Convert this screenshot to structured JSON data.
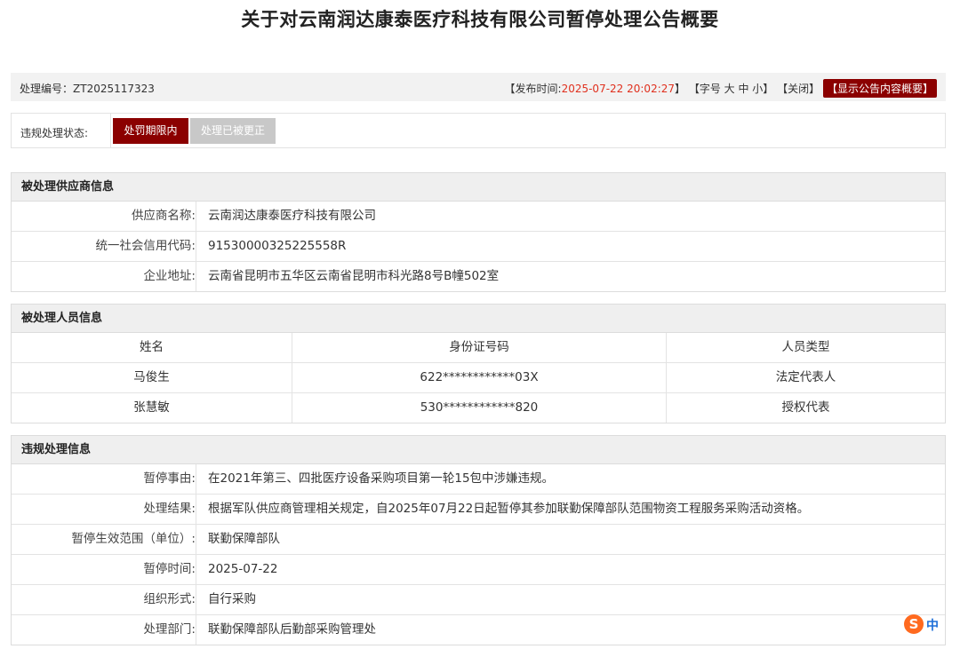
{
  "page": {
    "title": "关于对云南润达康泰医疗科技有限公司暂停处理公告概要"
  },
  "meta": {
    "serial_label": "处理编号：",
    "serial_value": "ZT2025117323",
    "publish_label_open": "【发布时间: ",
    "publish_time": "2025-07-22 20:02:27",
    "publish_close": "】",
    "font_size": "【字号 大 中 小】",
    "close": "【关闭】",
    "show_summary": "【显示公告内容概要】"
  },
  "status": {
    "label": "违规处理状态:",
    "active": "处罚期限内",
    "inactive": "处理已被更正"
  },
  "supplier": {
    "heading": "被处理供应商信息",
    "rows": [
      {
        "k": "供应商名称:",
        "v": "云南润达康泰医疗科技有限公司"
      },
      {
        "k": "统一社会信用代码:",
        "v": "91530000325225558R"
      },
      {
        "k": "企业地址:",
        "v": "云南省昆明市五华区云南省昆明市科光路8号B幢502室"
      }
    ]
  },
  "persons": {
    "heading": "被处理人员信息",
    "columns": [
      "姓名",
      "身份证号码",
      "人员类型"
    ],
    "rows": [
      [
        "马俊生",
        "622************03X",
        "法定代表人"
      ],
      [
        "张慧敏",
        "530************820",
        "授权代表"
      ]
    ]
  },
  "violation": {
    "heading": "违规处理信息",
    "rows": [
      {
        "k": "暂停事由:",
        "v": "在2021年第三、四批医疗设备采购项目第一轮15包中涉嫌违规。"
      },
      {
        "k": "处理结果:",
        "v": "根据军队供应商管理相关规定，自2025年07月22日起暂停其参加联勤保障部队范围物资工程服务采购活动资格。"
      },
      {
        "k": "暂停生效范围（单位）:",
        "v": "联勤保障部队"
      },
      {
        "k": "暂停时间:",
        "v": "2025-07-22"
      },
      {
        "k": "组织形式:",
        "v": "自行采购"
      },
      {
        "k": "处理部门:",
        "v": "联勤保障部队后勤部采购管理处"
      }
    ]
  },
  "ime": {
    "badge": "S",
    "lang": "中"
  },
  "colors": {
    "accent": "#8b0000",
    "publish_time": "#e0301e",
    "header_bg": "#efefef"
  }
}
